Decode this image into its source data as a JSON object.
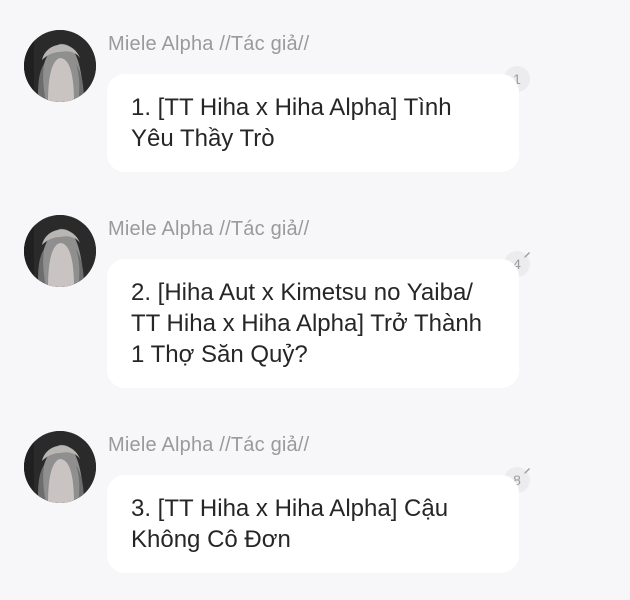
{
  "posts": [
    {
      "author": "Miele Alpha //Tác giả//",
      "text": "1. [TT Hiha x Hiha Alpha] Tình Yêu Thầy Trò",
      "reply_count": "1",
      "edited": false
    },
    {
      "author": "Miele Alpha //Tác giả//",
      "text": "2. [Hiha Aut x Kimetsu no Yaiba/ TT Hiha x Hiha Alpha] Trở Thành 1 Thợ Săn Quỷ?",
      "reply_count": "4",
      "edited": true
    },
    {
      "author": "Miele Alpha //Tác giả//",
      "text": "3. [TT Hiha x Hiha Alpha] Cậu Không Cô Đơn",
      "reply_count": "8",
      "edited": true
    }
  ],
  "icons": {
    "avatar": "avatar-image",
    "edited": "pencil-icon"
  },
  "colors": {
    "background": "#f7f7f9",
    "bubble": "#ffffff",
    "author": "#9a9a9a",
    "text": "#262626",
    "badge_bg": "#ececef"
  }
}
